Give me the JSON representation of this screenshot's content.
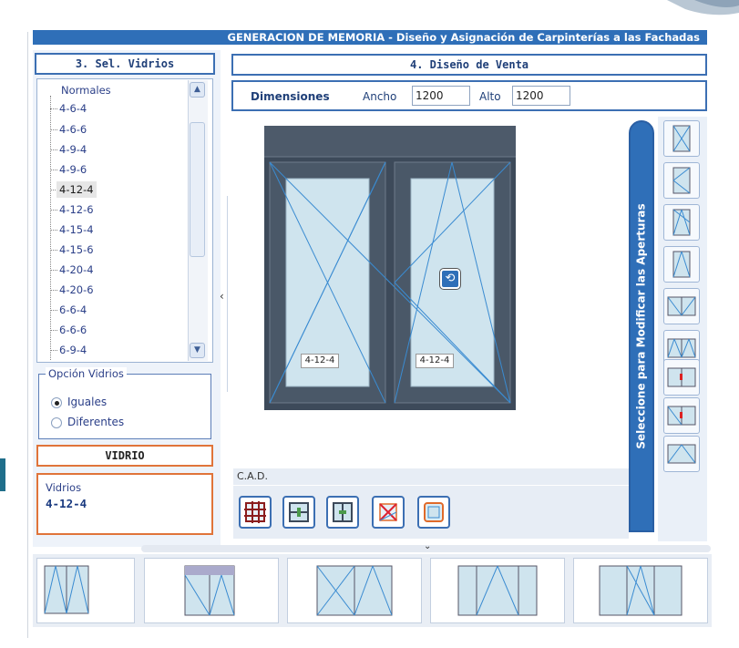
{
  "header": {
    "title": "GENERACION DE MEMORIA - Diseño y Asignación de Carpinterías a las Fachadas"
  },
  "glass_panel": {
    "title": "3. Sel. Vidrios",
    "group": "Normales",
    "items": [
      "4-6-4",
      "4-6-6",
      "4-9-4",
      "4-9-6",
      "4-12-4",
      "4-12-6",
      "4-15-4",
      "4-15-6",
      "4-20-4",
      "4-20-6",
      "6-6-4",
      "6-6-6",
      "6-9-4"
    ],
    "selected": "4-12-4"
  },
  "glass_option": {
    "legend": "Opción Vidrios",
    "options": [
      {
        "label": "Iguales",
        "checked": true
      },
      {
        "label": "Diferentes",
        "checked": false
      }
    ]
  },
  "vidrio": {
    "title": "VIDRIO",
    "label": "Vidrios",
    "value": "4-12-4"
  },
  "window_design": {
    "title": "4. Diseño de Venta",
    "dimensions_label": "Dimensiones",
    "width_label": "Ancho",
    "width_value": "1200",
    "height_label": "Alto",
    "height_value": "1200",
    "left_sash_glass": "4-12-4",
    "right_sash_glass": "4-12-4"
  },
  "cad": {
    "label": "C.A.D."
  },
  "openings": {
    "tab_label": "Seleccione para Modificar las Aperturas"
  },
  "colors": {
    "accent_blue": "#2f6fb8",
    "frame": "#3d4a5a",
    "glass": "#cfe4ee",
    "orange": "#e0743a"
  }
}
